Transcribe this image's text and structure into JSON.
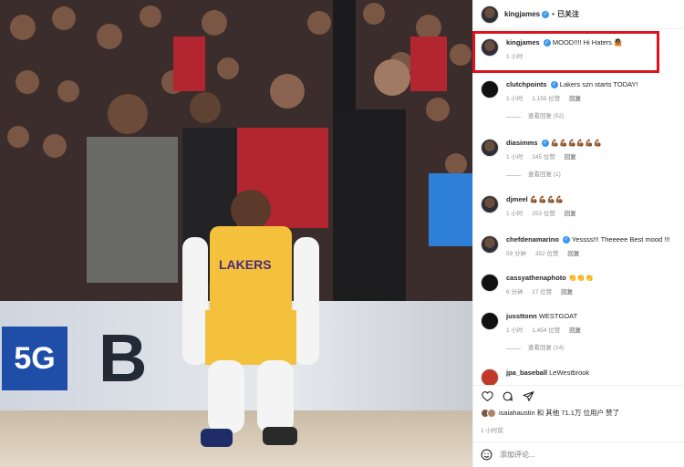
{
  "header": {
    "username": "kingjames",
    "separator": "•",
    "follow_status": "已关注"
  },
  "photo": {
    "adboard_logo": "5G",
    "adboard_text": "B"
  },
  "comments": [
    {
      "user": "kingjames",
      "text": "MOOD!!!! Hi Haters 🤷🏾",
      "time": "1 小时",
      "likes": "",
      "reply": "",
      "replies": ""
    },
    {
      "user": "clutchpoints",
      "text": "Lakers szn starts TODAY!",
      "time": "1 小时",
      "likes": "1,155 位赞",
      "reply": "回复",
      "replies": "查看回复 (52)"
    },
    {
      "user": "diasimms",
      "text": "💪🏾💪🏾💪🏾💪🏾💪🏾💪🏾",
      "time": "1 小时",
      "likes": "245 位赞",
      "reply": "回复",
      "replies": "查看回复 (1)"
    },
    {
      "user": "djmeel",
      "text": "💪🏾💪🏾💪🏾💪🏾",
      "time": "1 小时",
      "likes": "253 位赞",
      "reply": "回复",
      "replies": ""
    },
    {
      "user": "chefdenamarino",
      "text": "Yessss!!! Theeeee Best mood !!!",
      "time": "59 分钟",
      "likes": "352 位赞",
      "reply": "回复",
      "replies": ""
    },
    {
      "user": "cassyathenaphoto",
      "text": "👏👏👏",
      "time": "6 分钟",
      "likes": "17 位赞",
      "reply": "回复",
      "replies": ""
    },
    {
      "user": "jussttonn",
      "text": "WESTGOAT",
      "time": "1 小时",
      "likes": "1,454 位赞",
      "reply": "回复",
      "replies": "查看回复 (14)"
    },
    {
      "user": "jpa_baseball",
      "text": "LeWestbrook",
      "time": "",
      "likes": "",
      "reply": "",
      "replies": ""
    }
  ],
  "likes": {
    "text": "isaiahaustin 和 其他 71.1万 位用户 赞了"
  },
  "post_time": "1 小时前",
  "add_comment": {
    "placeholder": "添加评论..."
  },
  "colors": {
    "verified": "#3897f0",
    "highlight": "#e0121b"
  }
}
